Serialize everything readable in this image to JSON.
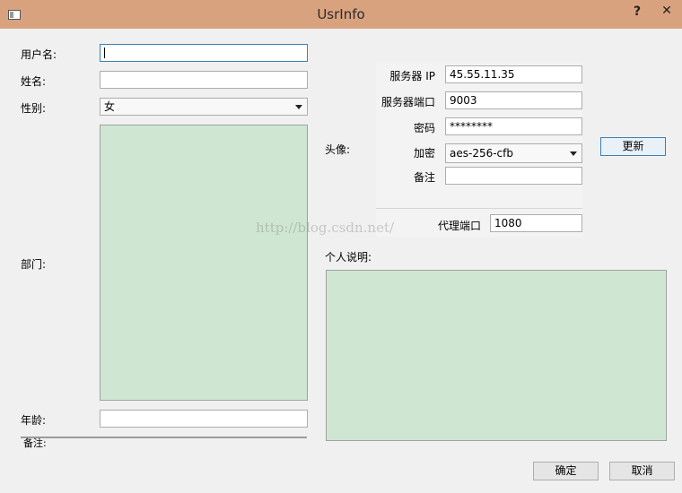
{
  "window": {
    "title": "UsrInfo",
    "help": "?",
    "close": "✕"
  },
  "labels": {
    "username": "用户名:",
    "name": "姓名:",
    "gender": "性别:",
    "department": "部门:",
    "age": "年龄:",
    "avatar": "头像:",
    "bio": "个人说明:",
    "server_ip": "服务器 IP",
    "server_port": "服务器端口",
    "password": "密码",
    "encryption": "加密",
    "remark": "备注",
    "proxy_port": "代理端口",
    "status": "备注:"
  },
  "fields": {
    "username": "",
    "name": "",
    "gender": "女",
    "age": "",
    "server_ip": "45.55.11.35",
    "server_port": "9003",
    "password": "********",
    "encryption": "aes-256-cfb",
    "remark": "",
    "proxy_port": "1080"
  },
  "buttons": {
    "update": "更新",
    "ok": "确定",
    "cancel": "取消"
  },
  "watermark": "http://blog.csdn.net/"
}
